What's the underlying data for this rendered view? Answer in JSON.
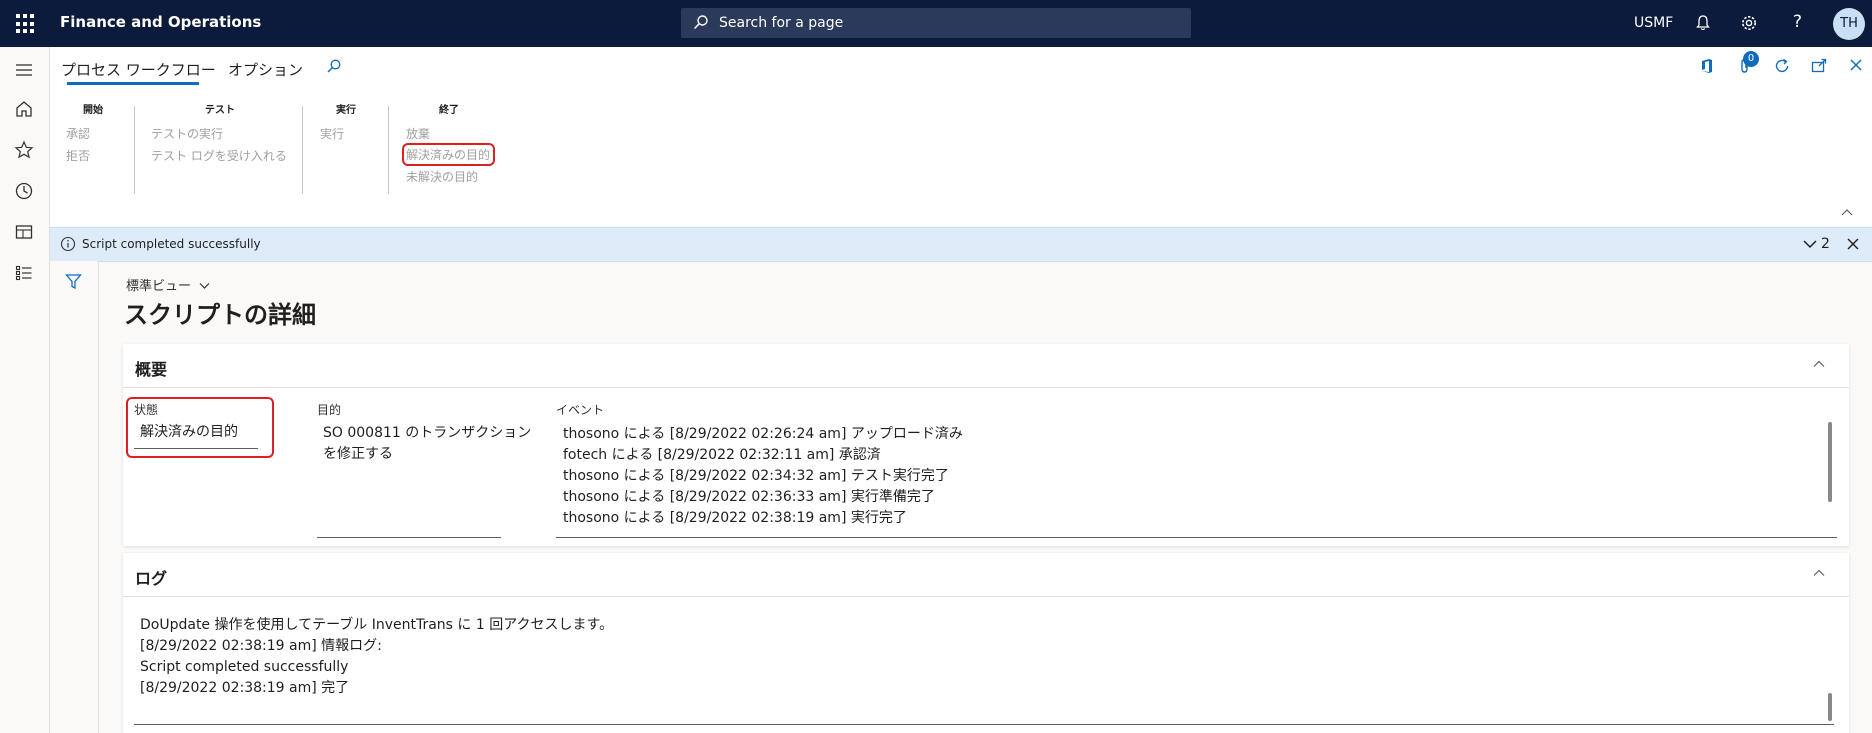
{
  "topbar": {
    "app_title": "Finance and Operations",
    "search_placeholder": "Search for a page",
    "company": "USMF",
    "avatar_initials": "TH"
  },
  "actionpane": {
    "tabs": [
      "プロセス ワークフロー",
      "オプション"
    ],
    "badge_count": "0",
    "groups": [
      {
        "title": "開始",
        "actions": [
          "承認",
          "拒否"
        ]
      },
      {
        "title": "テスト",
        "actions": [
          "テストの実行",
          "テスト ログを受け入れる"
        ]
      },
      {
        "title": "実行",
        "actions": [
          "実行"
        ]
      },
      {
        "title": "終了",
        "actions": [
          "放棄",
          "解決済みの目的",
          "未解決の目的"
        ]
      }
    ]
  },
  "message": {
    "text": "Script completed successfully",
    "count": "2"
  },
  "page": {
    "view_selector": "標準ビュー",
    "title": "スクリプトの詳細"
  },
  "summary": {
    "title": "概要",
    "status_label": "状態",
    "status_value": "解決済みの目的",
    "purpose_label": "目的",
    "purpose_lines": [
      "SO 000811 のトランザクション",
      "を修正する"
    ],
    "events_label": "イベント",
    "events": [
      "thosono による [8/29/2022 02:26:24 am] アップロード済み",
      "fotech による [8/29/2022 02:32:11 am] 承認済",
      "thosono による [8/29/2022 02:34:32 am] テスト実行完了",
      "thosono による [8/29/2022 02:36:33 am] 実行準備完了",
      "thosono による [8/29/2022 02:38:19 am] 実行完了"
    ]
  },
  "log": {
    "title": "ログ",
    "lines": [
      "DoUpdate 操作を使用してテーブル InventTrans に 1 回アクセスします。",
      "[8/29/2022 02:38:19 am] 情報ログ:",
      "Script completed successfully",
      "[8/29/2022 02:38:19 am] 完了"
    ]
  },
  "colors": {
    "nav_bg": "#0c1a3b",
    "accent": "#0f6cbd",
    "highlight_border": "#e02020",
    "message_bg": "#deecf9"
  }
}
